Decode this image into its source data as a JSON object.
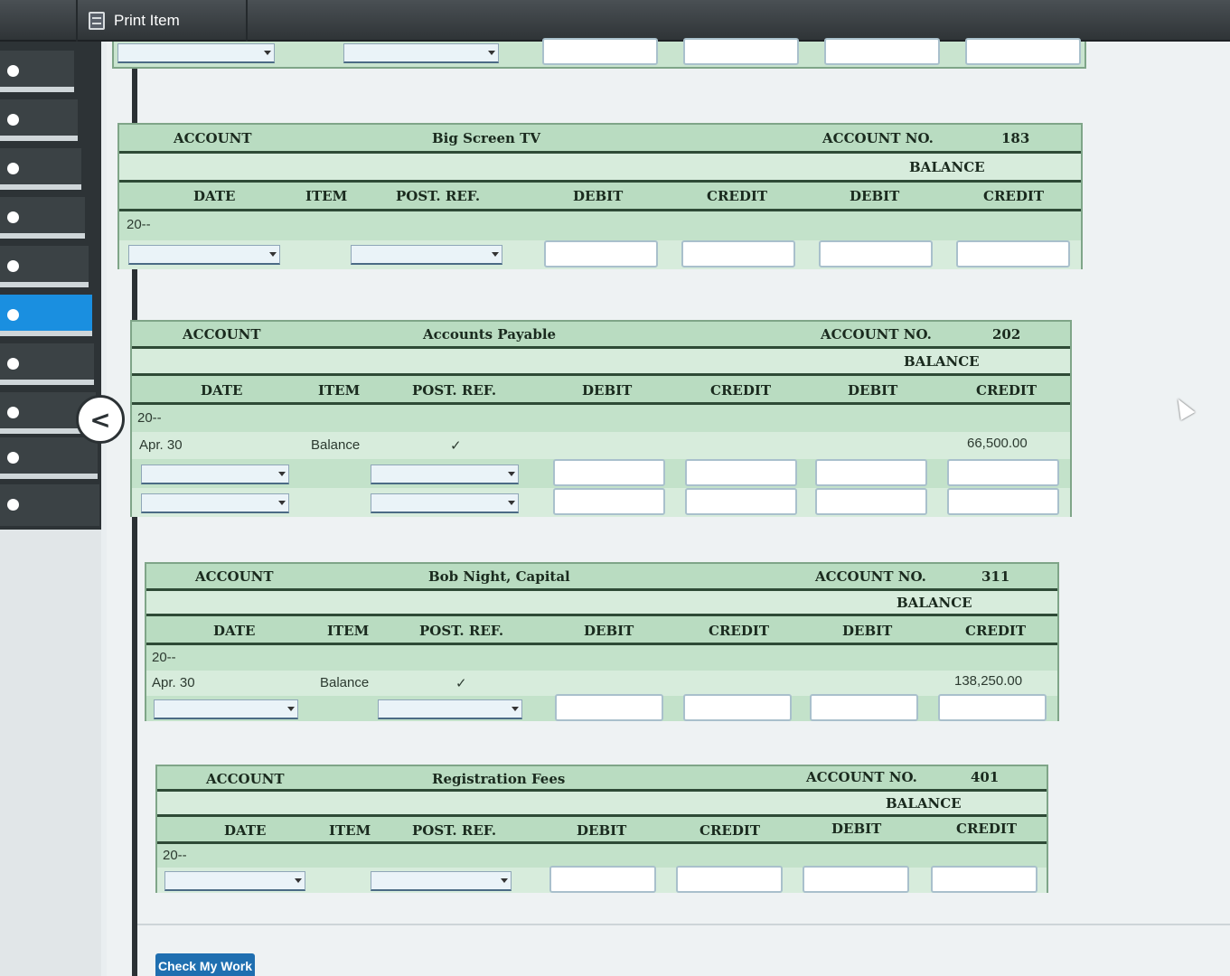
{
  "toolbar": {
    "print_label": "Print Item"
  },
  "nav": {
    "collapse_icon": "chevron-left-icon",
    "active_index": 5
  },
  "headers": {
    "account": "ACCOUNT",
    "account_no": "ACCOUNT NO.",
    "balance": "BALANCE",
    "date": "DATE",
    "item": "ITEM",
    "post_ref": "POST. REF.",
    "debit": "DEBIT",
    "credit": "CREDIT"
  },
  "ledgers": [
    {
      "name": "Big Screen TV",
      "number": "183",
      "year": "20--",
      "rows": []
    },
    {
      "name": "Accounts Payable",
      "number": "202",
      "year": "20--",
      "rows": [
        {
          "date": "Apr. 30",
          "item": "Balance",
          "post_ref": "✓",
          "credit_balance": "66,500.00"
        }
      ]
    },
    {
      "name": "Bob Night, Capital",
      "number": "311",
      "year": "20--",
      "rows": [
        {
          "date": "Apr. 30",
          "item": "Balance",
          "post_ref": "✓",
          "credit_balance": "138,250.00"
        }
      ]
    },
    {
      "name": "Registration Fees",
      "number": "401",
      "year": "20--",
      "rows": []
    }
  ],
  "footer": {
    "check_button": "Check My Work"
  }
}
